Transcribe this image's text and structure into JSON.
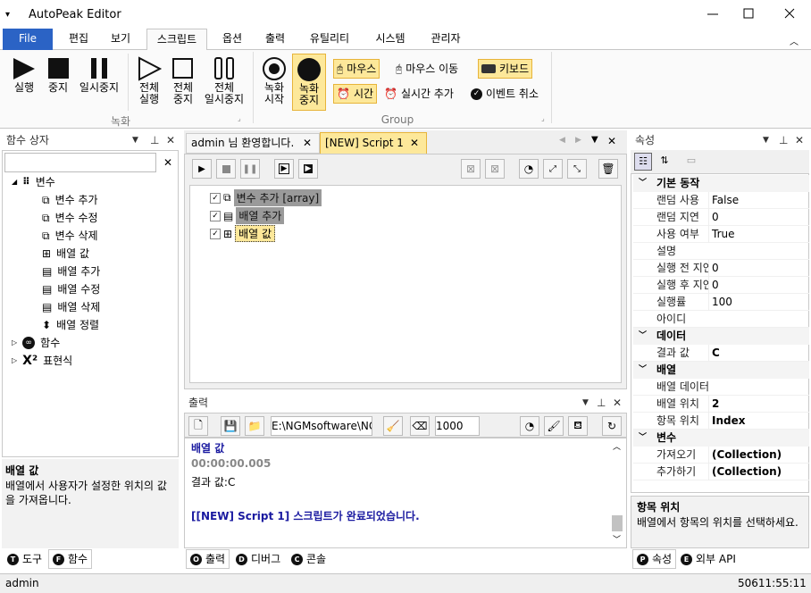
{
  "app": {
    "title": "AutoPeak Editor"
  },
  "ribbon_tabs": [
    "File",
    "편집",
    "보기",
    "스크립트",
    "옵션",
    "출력",
    "유틸리티",
    "시스템",
    "관리자"
  ],
  "ribbon": {
    "run": "실행",
    "stop": "중지",
    "pause": "일시중지",
    "run_all_1": "전체",
    "run_all_2": "실행",
    "stop_all_1": "전체",
    "stop_all_2": "중지",
    "pause_all_1": "전체",
    "pause_all_2": "일시중지",
    "record_start_1": "녹화",
    "record_start_2": "시작",
    "record_stop_1": "녹화",
    "record_stop_2": "중지",
    "mouse": "마우스",
    "mouse_move": "마우스 이동",
    "keyboard": "키보드",
    "time": "시간",
    "realtime_add": "실시간 추가",
    "event_cancel": "이벤트 취소",
    "group_record": "녹화",
    "group_group": "Group"
  },
  "left_panel": {
    "title": "함수 상자",
    "search_value": "",
    "tree": {
      "variables": "변수",
      "var_add": "변수 추가",
      "var_edit": "변수 수정",
      "var_delete": "변수 삭제",
      "array_value": "배열 값",
      "array_add": "배열 추가",
      "array_edit": "배열 수정",
      "array_delete": "배열 삭제",
      "array_sort": "배열 정렬",
      "functions": "함수",
      "expressions": "표현식"
    },
    "desc_title": "배열 값",
    "desc_text": "배열에서 사용자가 설정한 위치의 값을 가져옵니다.",
    "tab_tools": "도구",
    "tab_functions": "함수"
  },
  "doc_tabs": [
    "admin 님 환영합니다.",
    "[NEW] Script 1"
  ],
  "script": {
    "items": [
      "변수 추가 [array]",
      "배열 추가",
      "배열 값"
    ]
  },
  "output": {
    "title": "출력",
    "path": "E:\\NGMsoftware\\NG",
    "count": "1000",
    "line1": "배열 값",
    "line2": "00:00:00.005",
    "line3": "결과 값:C",
    "line4": "[[NEW] Script 1] 스크립트가 완료되었습니다.",
    "tab_output": "출력",
    "tab_debug": "디버그",
    "tab_console": "콘솔"
  },
  "properties": {
    "title": "속성",
    "categories": {
      "basic": "기본 동작",
      "data": "데이터",
      "array": "배열",
      "variables": "변수"
    },
    "rows": {
      "random_use": {
        "k": "랜덤 사용",
        "v": "False"
      },
      "random_delay": {
        "k": "랜덤 지연",
        "v": "0"
      },
      "enabled": {
        "k": "사용 여부",
        "v": "True"
      },
      "desc": {
        "k": "설명",
        "v": ""
      },
      "pre_delay": {
        "k": "실행 전 지연",
        "v": "0"
      },
      "post_delay": {
        "k": "실행 후 지연",
        "v": "0"
      },
      "rate": {
        "k": "실행률",
        "v": "100"
      },
      "id": {
        "k": "아이디",
        "v": ""
      },
      "result": {
        "k": "결과 값",
        "v": "C"
      },
      "array_data": {
        "k": "배열 데이터",
        "v": ""
      },
      "array_pos": {
        "k": "배열 위치",
        "v": "2"
      },
      "item_pos": {
        "k": "항목 위치",
        "v": "Index"
      },
      "get": {
        "k": "가져오기",
        "v": "(Collection)"
      },
      "set": {
        "k": "추가하기",
        "v": "(Collection)"
      }
    },
    "desc_title": "항목 위치",
    "desc_text": "배열에서 항목의 위치를 선택하세요.",
    "tab_props": "속성",
    "tab_api": "외부 API"
  },
  "status": {
    "user": "admin",
    "time": "50611:55:11"
  },
  "colors": {
    "file_tab": "#2b63c5",
    "highlight": "#fde89a",
    "blue_text": "#1a1aa0"
  }
}
